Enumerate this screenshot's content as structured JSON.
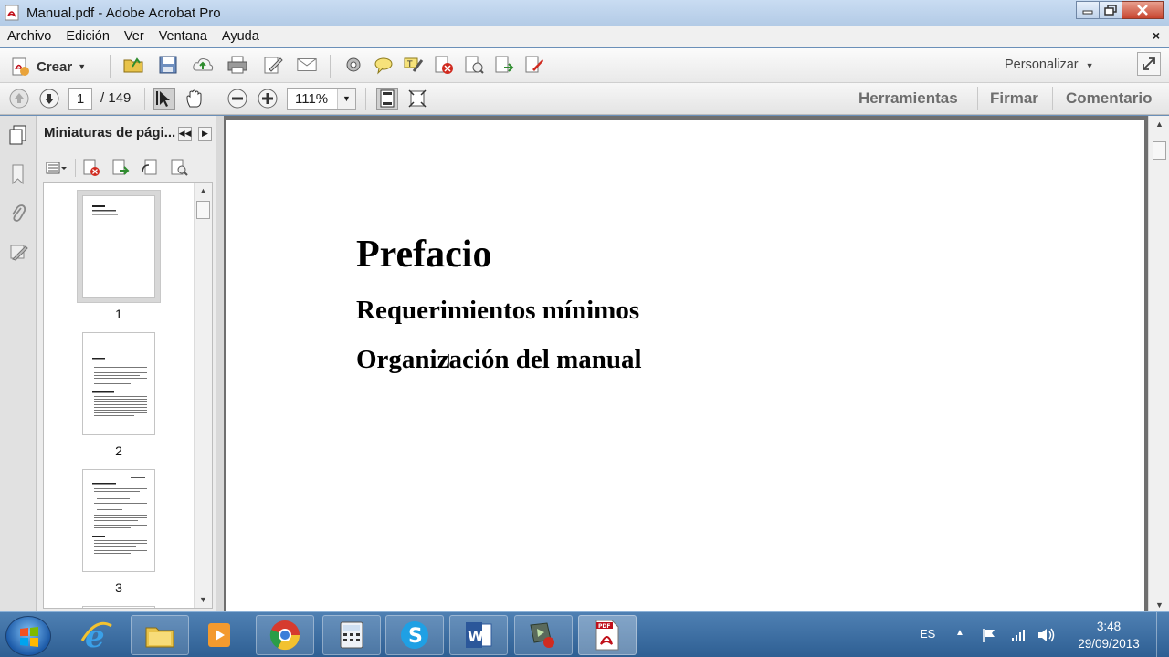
{
  "window": {
    "title": "Manual.pdf - Adobe Acrobat Pro",
    "controls": [
      "minimize",
      "maximize",
      "close"
    ]
  },
  "menu": {
    "items": [
      "Archivo",
      "Edición",
      "Ver",
      "Ventana",
      "Ayuda"
    ],
    "doc_close": "×"
  },
  "toolbar": {
    "create_label": "Crear",
    "personalize_label": "Personalizar",
    "icons": [
      "open-folder-icon",
      "save-icon",
      "upload-icon",
      "print-icon",
      "edit-icon",
      "email-icon",
      "settings-icon",
      "comment-icon",
      "highlight-icon",
      "delete-page-icon",
      "extract-page-icon",
      "insert-page-icon",
      "export-icon"
    ]
  },
  "navigation": {
    "current_page": "1",
    "page_total": "/  149",
    "zoom": "111%"
  },
  "panes": {
    "tools": "Herramientas",
    "sign": "Firmar",
    "comment": "Comentario"
  },
  "thumbnails": {
    "header": "Miniaturas de pági...",
    "pages": [
      {
        "number": "1",
        "selected": true
      },
      {
        "number": "2",
        "selected": false
      },
      {
        "number": "3",
        "selected": false
      }
    ]
  },
  "document": {
    "heading": "Prefacio",
    "sections": [
      "Requerimientos mínimos",
      "Organización del manual"
    ]
  },
  "taskbar": {
    "apps": [
      "start-button",
      "internet-explorer",
      "file-explorer",
      "media-player",
      "chrome",
      "calculator",
      "skype",
      "word",
      "media-encoder",
      "acrobat"
    ],
    "language": "ES",
    "time": "3:48",
    "date": "29/09/2013"
  },
  "colors": {
    "titlebar": "#c9dcf2",
    "taskbar": "#3a6a9e",
    "doc_background": "#6f6f6f"
  }
}
